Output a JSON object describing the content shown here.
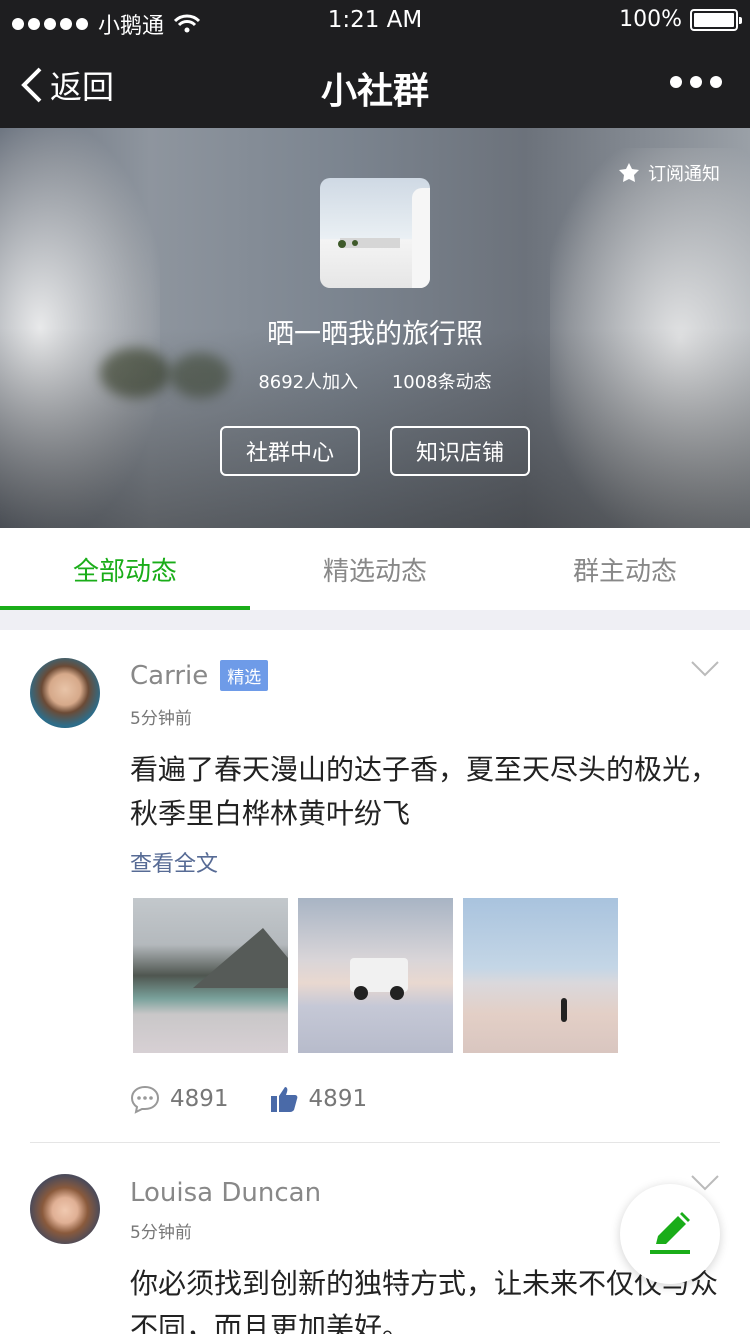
{
  "status_bar": {
    "carrier": "小鹅通",
    "time": "1:21 AM",
    "battery": "100%"
  },
  "nav": {
    "back_label": "返回",
    "title": "小社群"
  },
  "hero": {
    "subscribe_label": "订阅通知",
    "group_name": "晒一晒我的旅行照",
    "members": "8692人加入",
    "posts_count": "1008条动态",
    "button_center": "社群中心",
    "button_shop": "知识店铺"
  },
  "tabs": [
    {
      "label": "全部动态",
      "active": true
    },
    {
      "label": "精选动态",
      "active": false
    },
    {
      "label": "群主动态",
      "active": false
    }
  ],
  "posts": [
    {
      "author": "Carrie",
      "badge": "精选",
      "time": "5分钟前",
      "text": "看遍了春天漫山的达子香，夏至天尽头的极光，秋季里白桦林黄叶纷飞",
      "read_more": "查看全文",
      "comments": "4891",
      "likes": "4891"
    },
    {
      "author": "Louisa Duncan",
      "time": "5分钟前",
      "text": "你必须找到创新的独特方式，让未来不仅仅与众不同，而且更加美好。"
    }
  ],
  "colors": {
    "accent": "#1aad19",
    "link": "#576b95",
    "badge": "#6e9be8",
    "topbar": "#1e1e20"
  }
}
